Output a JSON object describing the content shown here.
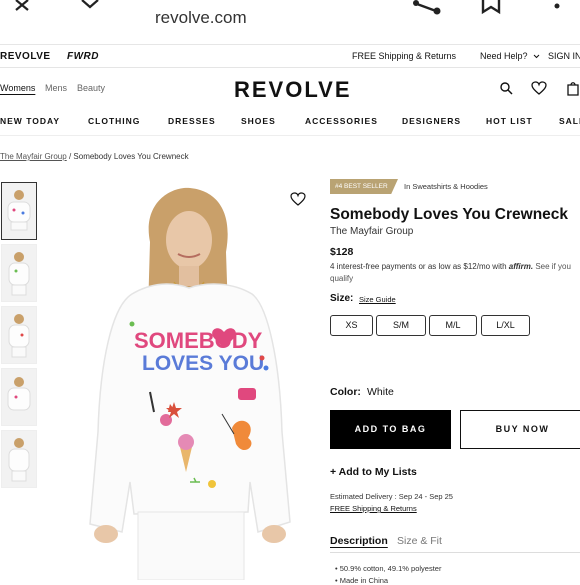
{
  "browser": {
    "url": "revolve.com"
  },
  "promo_bar": {
    "brand_primary": "REVOLVE",
    "brand_secondary": "FWRD",
    "shipping": "FREE Shipping & Returns",
    "help": "Need Help?",
    "sign_in": "SIGN IN"
  },
  "header": {
    "genders": [
      "Womens",
      "Mens",
      "Beauty"
    ],
    "active_gender": "Womens",
    "logo": "REVOLVE"
  },
  "nav": {
    "items": [
      "NEW TODAY",
      "CLOTHING",
      "DRESSES",
      "SHOES",
      "ACCESSORIES",
      "DESIGNERS",
      "HOT LIST",
      "SALE"
    ]
  },
  "breadcrumb": {
    "parent": "The Mayfair Group",
    "separator": "/",
    "current": "Somebody Loves You Crewneck"
  },
  "product": {
    "badge": "#4 BEST SELLER",
    "badge_category": "In Sweatshirts & Hoodies",
    "title": "Somebody Loves You Crewneck",
    "brand": "The Mayfair Group",
    "price": "$128",
    "afterpay_text": "4 interest-free payments or as low as $12/mo with",
    "afterpay_brand": "affirm.",
    "afterpay_see": "See if you qualify",
    "size_label": "Size:",
    "size_guide": "Size Guide",
    "sizes": [
      "XS",
      "S/M",
      "M/L",
      "L/XL"
    ],
    "color_label": "Color:",
    "color_value": "White",
    "add_to_bag": "ADD TO BAG",
    "buy_now": "BUY NOW",
    "add_to_lists": "+ Add to My Lists",
    "estimated_delivery": "Estimated Delivery : Sep 24 - Sep 25",
    "free_shipping": "FREE Shipping & Returns",
    "tabs": [
      "Description",
      "Size & Fit"
    ],
    "bullets": [
      "50.9% cotton, 49.1% polyester",
      "Made in China"
    ],
    "sweater_text_1": "SOMEBODY",
    "sweater_text_2": "LOVES YOU"
  },
  "colors": {
    "accent_badge": "#b9a373",
    "button_primary": "#000000"
  }
}
